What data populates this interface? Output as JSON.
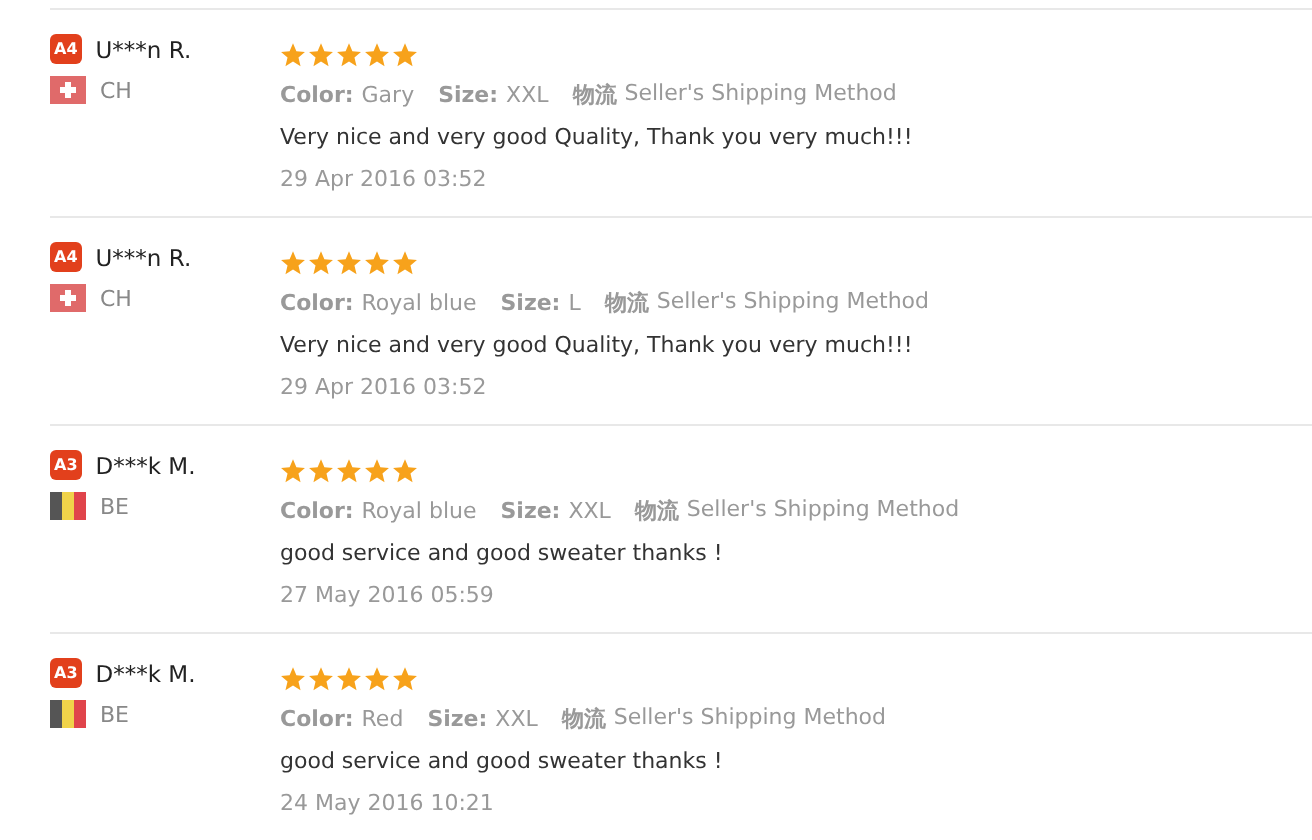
{
  "reviews": [
    {
      "level_badge": "A4",
      "name": "U***n R.",
      "flag": {
        "kind": "ch"
      },
      "country": "CH",
      "stars": 5,
      "attributes": [
        {
          "label": "Color:",
          "value": "Gary"
        },
        {
          "label": "Size:",
          "value": "XXL"
        },
        {
          "label": "物流",
          "value": "Seller's Shipping Method"
        }
      ],
      "comment": "Very nice and very good Quality, Thank you very much!!!",
      "date": "29 Apr 2016 03:52"
    },
    {
      "level_badge": "A4",
      "name": "U***n R.",
      "flag": {
        "kind": "ch"
      },
      "country": "CH",
      "stars": 5,
      "attributes": [
        {
          "label": "Color:",
          "value": "Royal blue"
        },
        {
          "label": "Size:",
          "value": "L"
        },
        {
          "label": "物流",
          "value": "Seller's Shipping Method"
        }
      ],
      "comment": "Very nice and very good Quality, Thank you very much!!!",
      "date": "29 Apr 2016 03:52"
    },
    {
      "level_badge": "A3",
      "name": "D***k M.",
      "flag": {
        "kind": "be"
      },
      "country": "BE",
      "stars": 5,
      "attributes": [
        {
          "label": "Color:",
          "value": "Royal blue"
        },
        {
          "label": "Size:",
          "value": "XXL"
        },
        {
          "label": "物流",
          "value": "Seller's Shipping Method"
        }
      ],
      "comment": "good service and good sweater thanks !",
      "date": "27 May 2016 05:59"
    },
    {
      "level_badge": "A3",
      "name": "D***k M.",
      "flag": {
        "kind": "be"
      },
      "country": "BE",
      "stars": 5,
      "attributes": [
        {
          "label": "Color:",
          "value": "Red"
        },
        {
          "label": "Size:",
          "value": "XXL"
        },
        {
          "label": "物流",
          "value": "Seller's Shipping Method"
        }
      ],
      "comment": "good service and good sweater thanks !",
      "date": "24 May 2016 10:21"
    }
  ]
}
